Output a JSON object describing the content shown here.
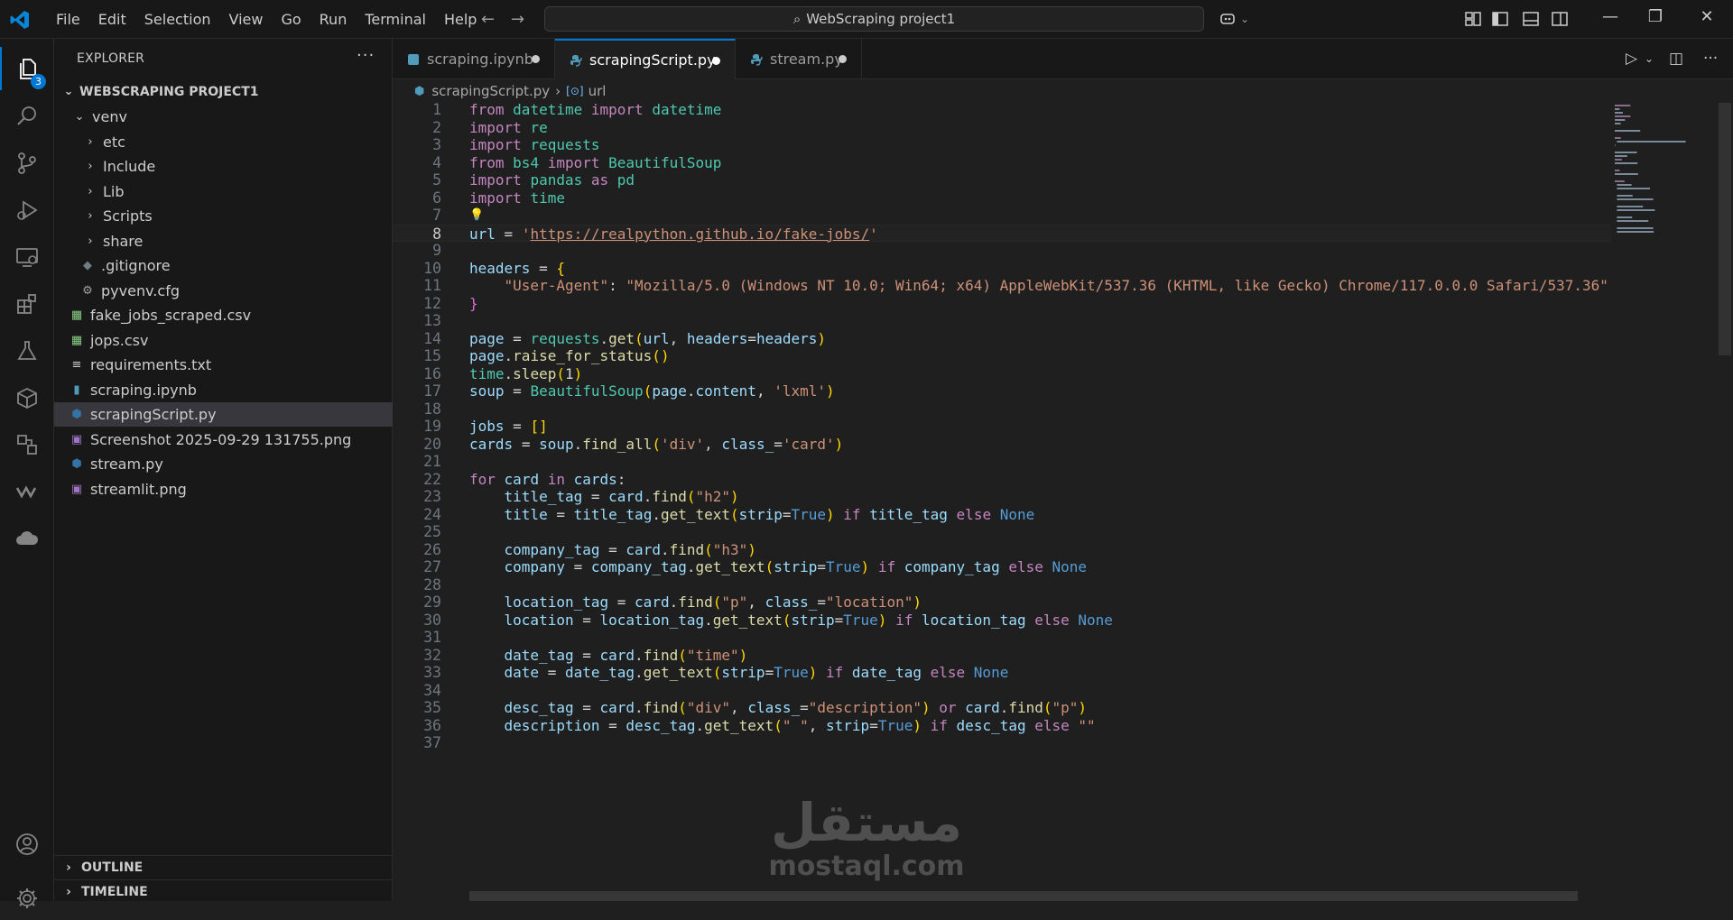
{
  "menu": [
    "File",
    "Edit",
    "Selection",
    "View",
    "Go",
    "Run",
    "Terminal",
    "Help"
  ],
  "search": {
    "text": "WebScraping project1"
  },
  "activity": {
    "explorer_badge": "3"
  },
  "sidebar": {
    "title": "EXPLORER",
    "more": "···",
    "project": "WEBSCRAPING PROJECT1",
    "items": [
      {
        "label": "venv"
      },
      {
        "label": "etc"
      },
      {
        "label": "Include"
      },
      {
        "label": "Lib"
      },
      {
        "label": "Scripts"
      },
      {
        "label": "share"
      },
      {
        "label": ".gitignore"
      },
      {
        "label": "pyvenv.cfg"
      },
      {
        "label": "fake_jobs_scraped.csv"
      },
      {
        "label": "jops.csv"
      },
      {
        "label": "requirements.txt"
      },
      {
        "label": "scraping.ipynb"
      },
      {
        "label": "scrapingScript.py"
      },
      {
        "label": "Screenshot 2025-09-29 131755.png"
      },
      {
        "label": "stream.py"
      },
      {
        "label": "streamlit.png"
      }
    ],
    "outline": "OUTLINE",
    "timeline": "TIMELINE"
  },
  "tabs": [
    {
      "label": "scraping.ipynb"
    },
    {
      "label": "scrapingScript.py"
    },
    {
      "label": "stream.py"
    }
  ],
  "breadcrumb": {
    "file": "scrapingScript.py",
    "symbol": "url"
  },
  "editor": {
    "lines": [
      "from datetime import datetime",
      "import re",
      "import requests",
      "from bs4 import BeautifulSoup",
      "import pandas as pd",
      "import time",
      "",
      "url = 'https://realpython.github.io/fake-jobs/'",
      "",
      "headers = {",
      "    \"User-Agent\": \"Mozilla/5.0 (Windows NT 10.0; Win64; x64) AppleWebKit/537.36 (KHTML, like Gecko) Chrome/117.0.0.0 Safari/537.36\"",
      "}",
      "",
      "page = requests.get(url, headers=headers)",
      "page.raise_for_status()",
      "time.sleep(1)",
      "soup = BeautifulSoup(page.content, 'lxml')",
      "",
      "jobs = []",
      "cards = soup.find_all('div', class_='card')",
      "",
      "for card in cards:",
      "    title_tag = card.find(\"h2\")",
      "    title = title_tag.get_text(strip=True) if title_tag else None",
      "",
      "    company_tag = card.find(\"h3\")",
      "    company = company_tag.get_text(strip=True) if company_tag else None",
      "",
      "    location_tag = card.find(\"p\", class_=\"location\")",
      "    location = location_tag.get_text(strip=True) if location_tag else None",
      "",
      "    date_tag = card.find(\"time\")",
      "    date = date_tag.get_text(strip=True) if date_tag else None",
      "",
      "    desc_tag = card.find(\"div\", class_=\"description\") or card.find(\"p\")",
      "    description = desc_tag.get_text(\" \", strip=True) if desc_tag else \"\"",
      ""
    ]
  },
  "watermark": {
    "arabic": "مستقل",
    "latin": "mostaql.com"
  },
  "colors": {
    "accent": "#0078d4",
    "keyword": "#c586c0",
    "string": "#ce9178",
    "function": "#dcdcaa",
    "variable": "#9cdcfe",
    "type": "#4ec9b0",
    "constant": "#569cd6"
  }
}
